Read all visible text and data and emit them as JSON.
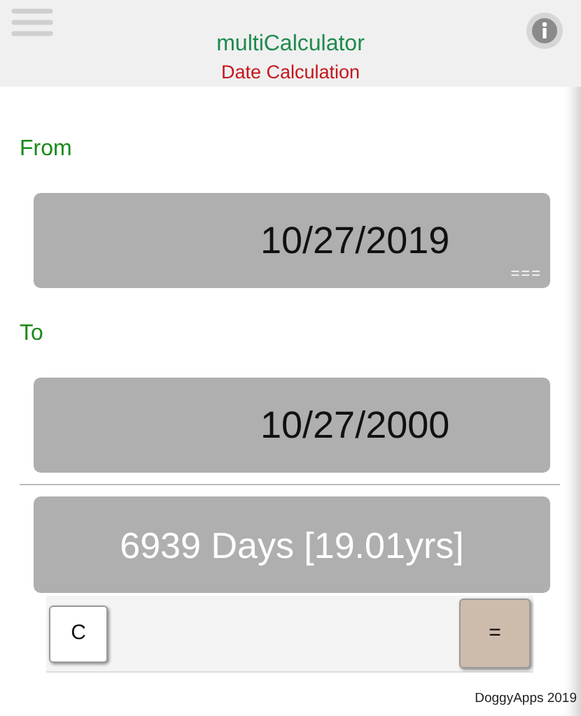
{
  "header": {
    "title": "multiCalculator",
    "subtitle": "Date Calculation"
  },
  "fields": [
    {
      "label": "From",
      "value": "10/27/2019",
      "hint": "==="
    },
    {
      "label": "To",
      "value": "10/27/2000"
    }
  ],
  "result": "6939 Days [19.01yrs]",
  "buttons": [
    {
      "label": "C",
      "kind": "clear"
    },
    {
      "label": "=",
      "kind": "equals"
    }
  ],
  "footer": "DoggyApps 2019"
}
